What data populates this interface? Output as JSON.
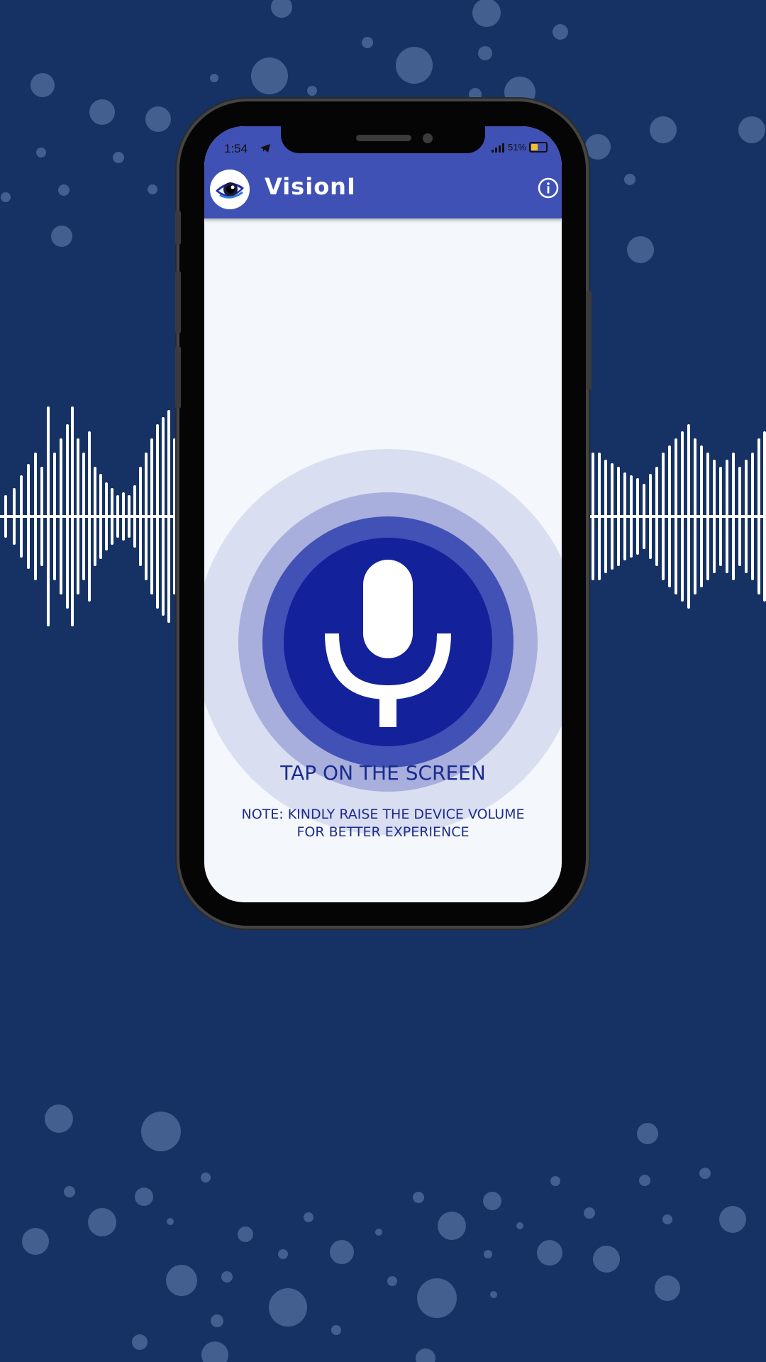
{
  "status_bar": {
    "time": "1:54",
    "battery": "51%"
  },
  "app": {
    "title": "VisionI"
  },
  "main": {
    "prompt": "TAP ON THE SCREEN",
    "note": "NOTE: KINDLY RAISE THE DEVICE VOLUME FOR BETTER EXPERIENCE"
  },
  "icons": [
    "telegram-icon",
    "signal-icon",
    "battery-icon",
    "eye-logo-icon",
    "info-icon",
    "microphone-icon"
  ],
  "colors": {
    "background": "#163264",
    "appbar": "#3f51b5",
    "mic_core": "#13229a",
    "text": "#1a2b8f"
  }
}
